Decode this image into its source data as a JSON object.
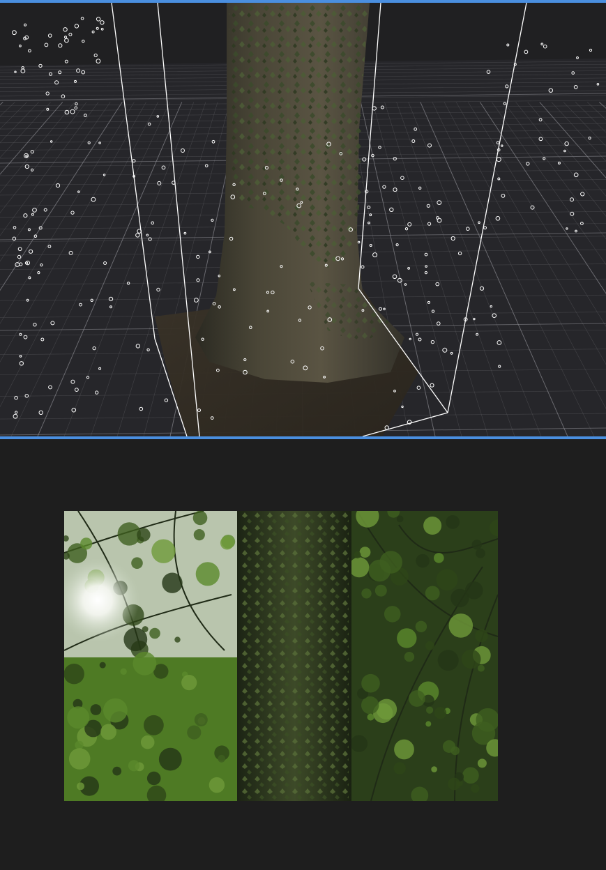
{
  "viewer": {
    "colors": {
      "accent": "#4a8fe0",
      "viewport_background": "#202022",
      "panel_background": "#1e1e1e",
      "grid_line": "#5a5a5e",
      "camera_marker": "#ffffff",
      "bounding_box": "#ffffff"
    },
    "scene": {
      "subject": "tree-trunk-point-cloud",
      "elements": [
        "reconstructed-mesh",
        "ground-grid",
        "camera-positions",
        "bounding-box"
      ]
    },
    "preview": {
      "subject": "source-photo"
    }
  }
}
